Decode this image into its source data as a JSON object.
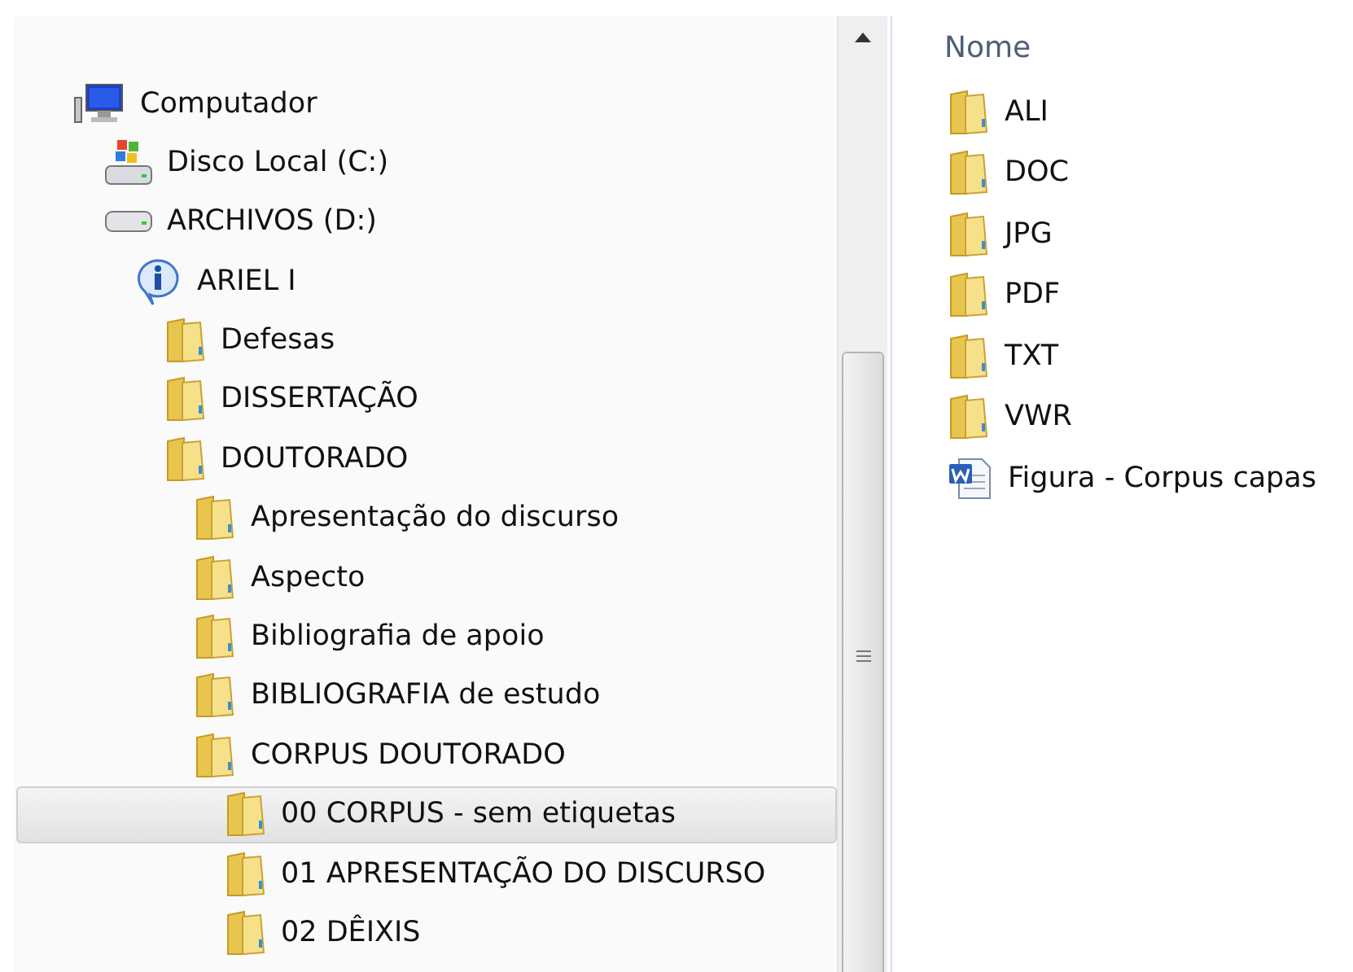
{
  "tree": [
    {
      "label": "Computador",
      "kind": "computer",
      "selected": false,
      "children": [
        {
          "label": "Disco Local (C:)",
          "kind": "system-drive",
          "selected": false
        },
        {
          "label": "ARCHIVOS (D:)",
          "kind": "drive",
          "selected": false,
          "children": [
            {
              "label": "ARIEL I",
              "kind": "info",
              "selected": false,
              "children": [
                {
                  "label": "Defesas",
                  "kind": "folder",
                  "selected": false
                },
                {
                  "label": "DISSERTAÇÃO",
                  "kind": "folder",
                  "selected": false
                },
                {
                  "label": "DOUTORADO",
                  "kind": "folder",
                  "selected": false,
                  "children": [
                    {
                      "label": "Apresentação do discurso",
                      "kind": "folder",
                      "selected": false
                    },
                    {
                      "label": "Aspecto",
                      "kind": "folder",
                      "selected": false
                    },
                    {
                      "label": "Bibliografia de apoio",
                      "kind": "folder",
                      "selected": false
                    },
                    {
                      "label": "BIBLIOGRAFIA de estudo",
                      "kind": "folder",
                      "selected": false
                    },
                    {
                      "label": "CORPUS DOUTORADO",
                      "kind": "folder",
                      "selected": false,
                      "children": [
                        {
                          "label": "00 CORPUS - sem etiquetas",
                          "kind": "folder",
                          "selected": true
                        },
                        {
                          "label": "01 APRESENTAÇÃO DO DISCURSO",
                          "kind": "folder",
                          "selected": false
                        },
                        {
                          "label": "02 DÊIXIS",
                          "kind": "folder",
                          "selected": false
                        }
                      ]
                    }
                  ]
                }
              ]
            }
          ]
        }
      ]
    }
  ],
  "column_header": "Nome",
  "files": [
    {
      "name": "ALI",
      "kind": "folder"
    },
    {
      "name": "DOC",
      "kind": "folder"
    },
    {
      "name": "JPG",
      "kind": "folder"
    },
    {
      "name": "PDF",
      "kind": "folder"
    },
    {
      "name": "TXT",
      "kind": "folder"
    },
    {
      "name": "VWR",
      "kind": "folder"
    },
    {
      "name": "Figura - Corpus capas",
      "kind": "word"
    }
  ]
}
